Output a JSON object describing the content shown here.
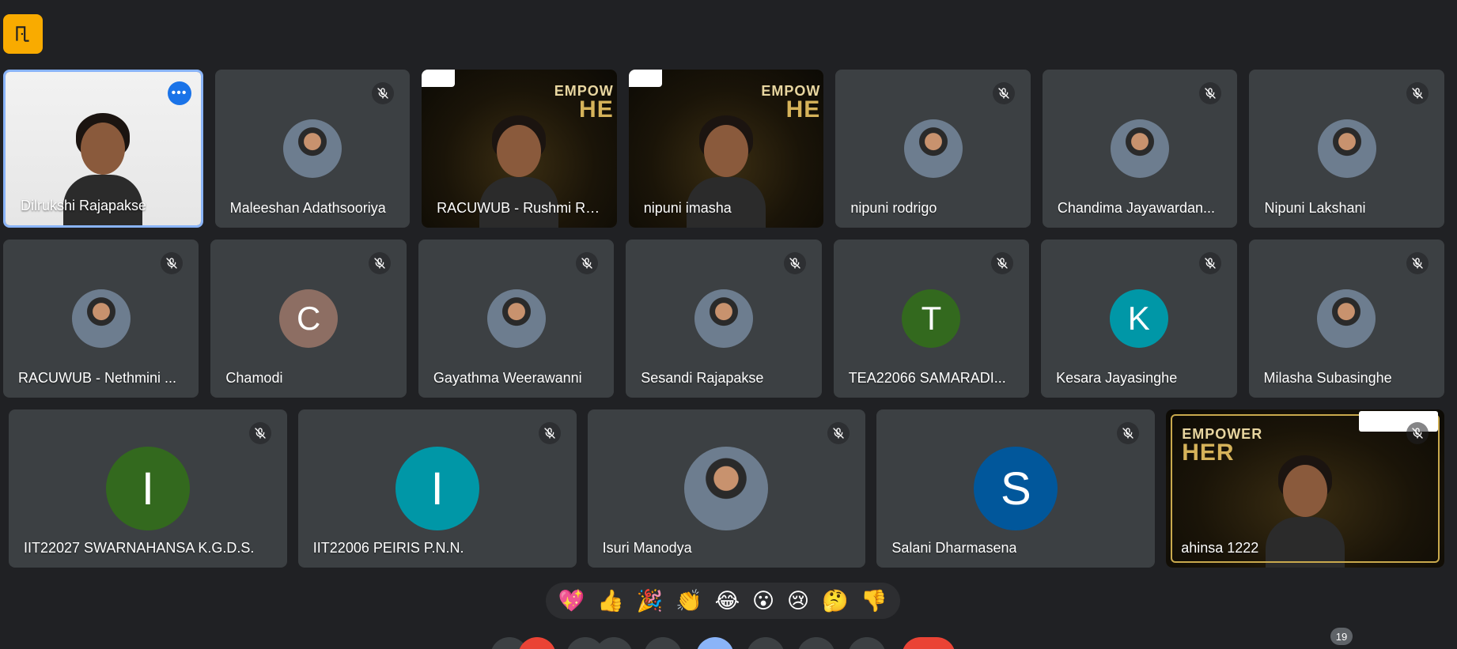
{
  "meeting": {
    "participant_count": "19",
    "colors": {
      "background": "#202124",
      "tile": "#3c4043",
      "accent": "#8ab4f8",
      "badge": "#f9ab00"
    }
  },
  "tiles_row1": [
    {
      "name": "Dilrukshi Rajapakse",
      "kind": "video-white",
      "active": true
    },
    {
      "name": "Maleeshan Adathsooriya",
      "kind": "photo",
      "muted": true
    },
    {
      "name": "RACUWUB - Rushmi Ro...",
      "kind": "video-golden",
      "brand": "EMPOW",
      "brand_big": "HE"
    },
    {
      "name": "nipuni imasha",
      "kind": "video-golden",
      "brand": "EMPOW",
      "brand_big": "HE"
    },
    {
      "name": "nipuni rodrigo",
      "kind": "photo",
      "muted": true
    },
    {
      "name": "Chandima Jayawardan...",
      "kind": "photo",
      "muted": true
    },
    {
      "name": "Nipuni Lakshani",
      "kind": "photo",
      "muted": true
    }
  ],
  "tiles_row2": [
    {
      "name": "RACUWUB - Nethmini ...",
      "kind": "photo",
      "muted": true
    },
    {
      "name": "Chamodi",
      "kind": "letter",
      "letter": "C",
      "color": "#8d6e63",
      "muted": true
    },
    {
      "name": "Gayathma Weerawanni",
      "kind": "photo",
      "muted": true
    },
    {
      "name": "Sesandi Rajapakse",
      "kind": "photo",
      "muted": true
    },
    {
      "name": "TEA22066 SAMARADI...",
      "kind": "letter",
      "letter": "T",
      "color": "#33691e",
      "muted": true
    },
    {
      "name": "Kesara Jayasinghe",
      "kind": "letter",
      "letter": "K",
      "color": "#0097a7",
      "muted": true
    },
    {
      "name": "Milasha Subasinghe",
      "kind": "photo",
      "muted": true
    }
  ],
  "tiles_row3": [
    {
      "name": "IIT22027 SWARNAHANSA K.G.D.S.",
      "kind": "letter",
      "letter": "I",
      "color": "#33691e",
      "muted": true
    },
    {
      "name": "IIT22006 PEIRIS P.N.N.",
      "kind": "letter",
      "letter": "I",
      "color": "#0097a7",
      "muted": true
    },
    {
      "name": "Isuri Manodya",
      "kind": "photo",
      "muted": true
    },
    {
      "name": "Salani Dharmasena",
      "kind": "letter",
      "letter": "S",
      "color": "#01579b",
      "muted": true
    },
    {
      "name": "ahinsa 1222",
      "kind": "video-framed",
      "brand": "EMPOWER",
      "brand_big": "HER",
      "muted": true
    }
  ],
  "reactions": [
    "💖",
    "👍",
    "🎉",
    "👏",
    "😂",
    "😮",
    "😢",
    "🤔",
    "👎"
  ]
}
